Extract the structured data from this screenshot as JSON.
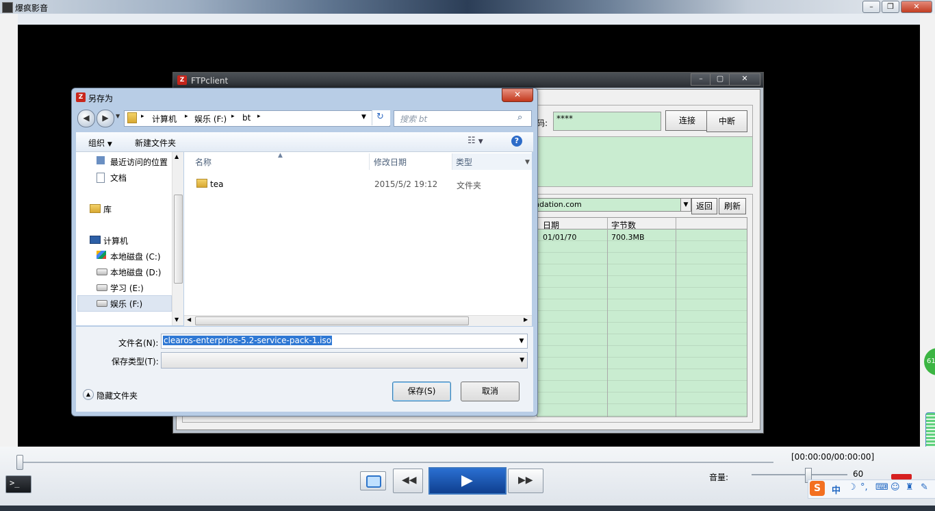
{
  "player": {
    "title": "爆疯影音",
    "time": "[00:00:00/00:00:00]",
    "volume_label": "音量:",
    "volume_value": "60",
    "side_badge": "61"
  },
  "ftp": {
    "title": "FTPclient",
    "password_label": "码:",
    "password_value": "****",
    "connect": "连接",
    "disconnect": "中断",
    "address": "ndation.com",
    "back": "返回",
    "refresh": "刷新",
    "columns": [
      "日期",
      "字节数"
    ],
    "row": {
      "date": "01/01/70",
      "size": "700.3MB"
    }
  },
  "dialog": {
    "title": "另存为",
    "breadcrumb": [
      "计算机",
      "娱乐 (F:)",
      "bt"
    ],
    "search_placeholder": "搜索 bt",
    "organize": "组织",
    "new_folder": "新建文件夹",
    "nav": {
      "recent": "最近访问的位置",
      "documents": "文档",
      "libraries": "库",
      "computer": "计算机",
      "drive_c": "本地磁盘 (C:)",
      "drive_d": "本地磁盘 (D:)",
      "drive_e": "学习 (E:)",
      "drive_f": "娱乐 (F:)"
    },
    "columns": {
      "name": "名称",
      "date": "修改日期",
      "type": "类型"
    },
    "files": [
      {
        "name": "tea",
        "date": "2015/5/2 19:12",
        "type": "文件夹"
      }
    ],
    "filename_label": "文件名(N):",
    "filename_value": "clearos-enterprise-5.2-service-pack-1.iso",
    "filetype_label": "保存类型(T):",
    "hide_folders": "隐藏文件夹",
    "save": "保存(S)",
    "cancel": "取消"
  },
  "ime": {
    "lang": "中"
  }
}
